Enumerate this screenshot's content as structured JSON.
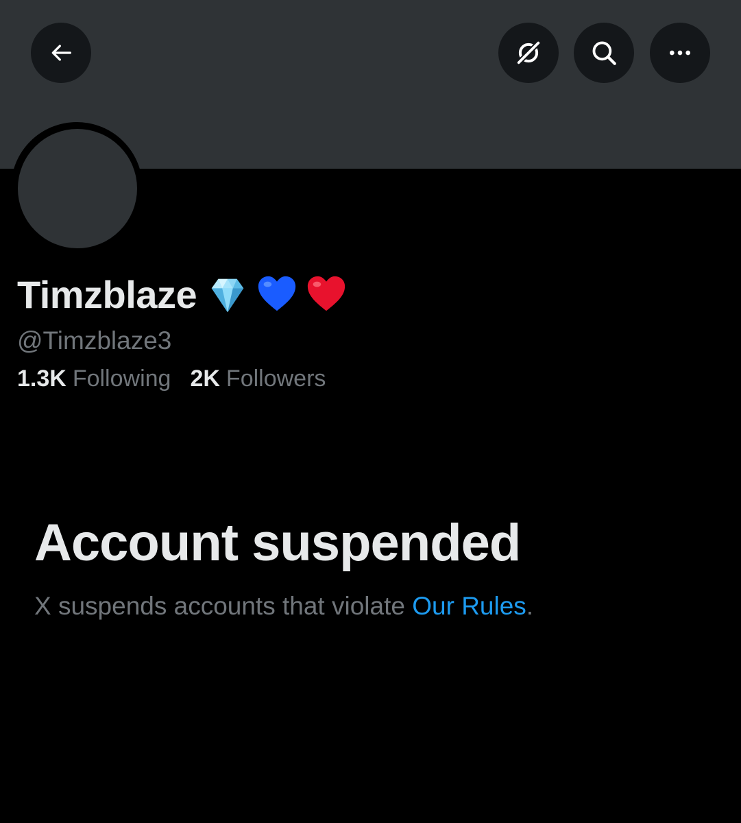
{
  "header": {
    "back_icon": "arrow-left-icon",
    "grok_icon": "grok-icon",
    "search_icon": "search-icon",
    "more_icon": "more-horizontal-icon"
  },
  "profile": {
    "display_name": "Timzblaze",
    "name_emojis": [
      "gem-icon",
      "blue-heart-icon",
      "red-heart-icon"
    ],
    "handle": "@Timzblaze3",
    "following_count": "1.3K",
    "following_label": "Following",
    "followers_count": "2K",
    "followers_label": "Followers"
  },
  "suspension": {
    "title": "Account suspended",
    "message": "X suspends accounts that violate ",
    "link_text": "Our Rules",
    "message_end": "."
  },
  "colors": {
    "background": "#000000",
    "banner": "#2f3336",
    "primary_text": "#e7e9ea",
    "secondary_text": "#71767b",
    "link": "#1d9bf0"
  }
}
